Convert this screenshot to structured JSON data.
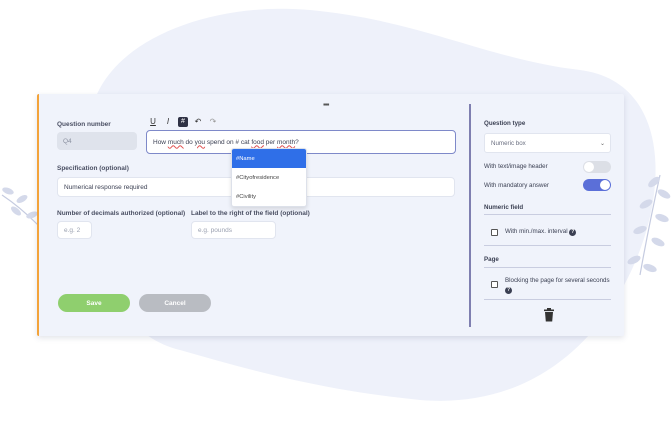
{
  "left": {
    "question_number_label": "Question number",
    "question_number_value": "Q4",
    "question_text": {
      "p1": "How ",
      "w1": "much",
      "p2": " do ",
      "w2": "you",
      "p3": " spend on ",
      "w3": "#",
      "p4": " cat ",
      "w4": "food",
      "p5": " per ",
      "w5": "month",
      "p6": "?"
    },
    "toolbar": {
      "underline": "U",
      "italic": "I",
      "hashtag": "#",
      "undo": "↶",
      "redo": "↷"
    },
    "suggestions": [
      "#Name",
      "#Cityofresidence",
      "#Civility"
    ],
    "specification_label": "Specification (optional)",
    "specification_value": "Numerical response required",
    "decimals_label": "Number of decimals authorized (optional)",
    "decimals_placeholder": "e.g. 2",
    "right_label_label": "Label to the right of the field (optional)",
    "right_label_placeholder": "e.g. pounds",
    "save_label": "Save",
    "cancel_label": "Cancel"
  },
  "right": {
    "question_type_label": "Question type",
    "question_type_value": "Numeric box",
    "text_image_header_label": "With text/image header",
    "text_image_header_on": false,
    "mandatory_label": "With mandatory answer",
    "mandatory_on": true,
    "numeric_field_label": "Numeric field",
    "min_max_label": "With min./max. interval",
    "page_label": "Page",
    "blocking_label": "Blocking the page for several seconds"
  },
  "colors": {
    "accent_orange": "#f3a33a",
    "toggle_on": "#5b6fd8",
    "save_green": "#8fcf6e",
    "dropdown_active": "#2f6fe8"
  }
}
